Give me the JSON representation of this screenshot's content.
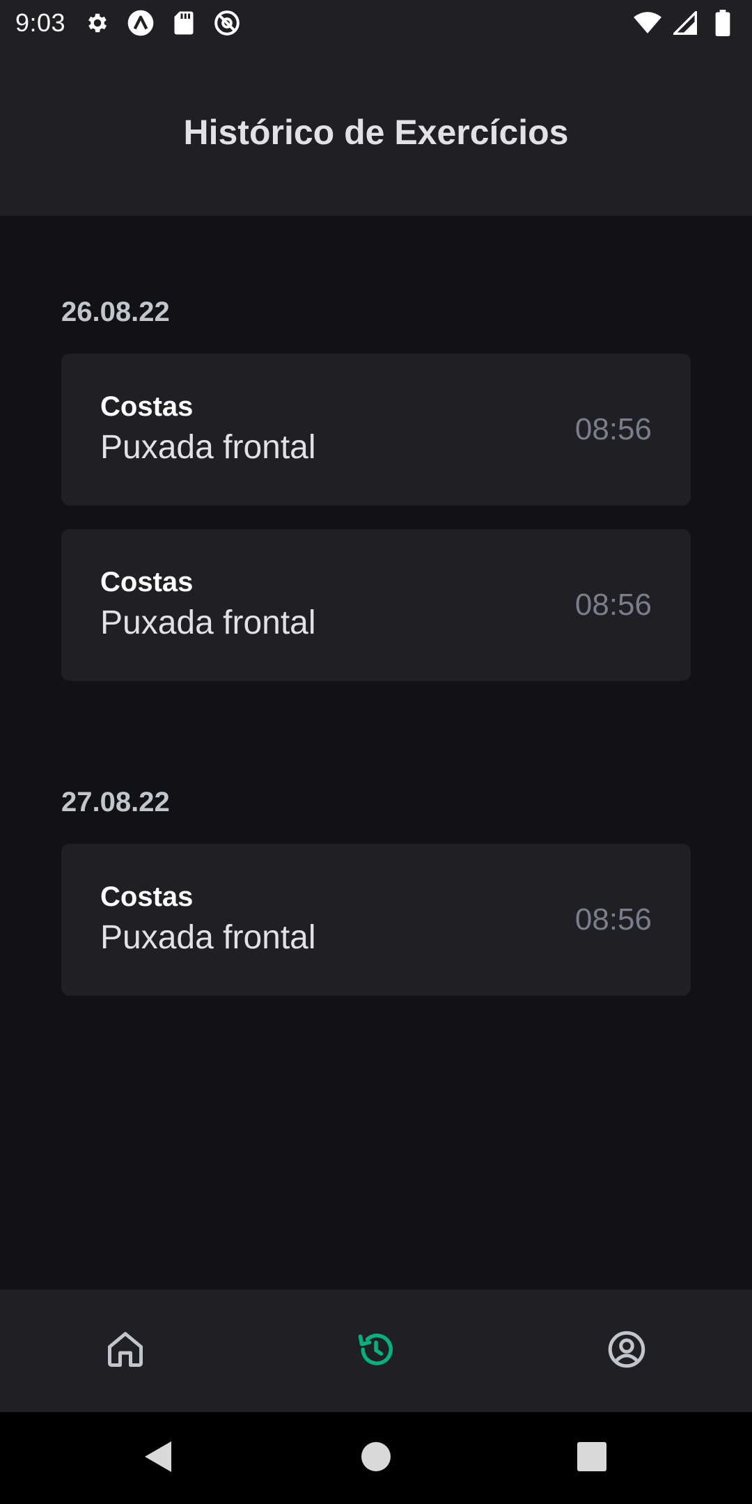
{
  "status_bar": {
    "time": "9:03",
    "icons": [
      "settings-icon",
      "app-logo-icon",
      "sd-card-icon",
      "at-icon"
    ],
    "right_icons": [
      "wifi-icon",
      "signal-icon",
      "battery-icon"
    ]
  },
  "header": {
    "title": "Histórico de Exercícios"
  },
  "history": [
    {
      "date": "26.08.22",
      "items": [
        {
          "group": "Costas",
          "name": "Puxada frontal",
          "time": "08:56"
        },
        {
          "group": "Costas",
          "name": "Puxada frontal",
          "time": "08:56"
        }
      ]
    },
    {
      "date": "27.08.22",
      "items": [
        {
          "group": "Costas",
          "name": "Puxada frontal",
          "time": "08:56"
        }
      ]
    }
  ],
  "tab_bar": {
    "tabs": [
      {
        "icon": "home-icon",
        "active": false
      },
      {
        "icon": "history-icon",
        "active": true
      },
      {
        "icon": "profile-icon",
        "active": false
      }
    ]
  },
  "colors": {
    "accent": "#00B37E",
    "background": "#121214",
    "surface": "#202024",
    "icon_inactive": "#c4c4cc"
  },
  "system_nav": {
    "buttons": [
      "back-icon",
      "home-circle-icon",
      "recents-icon"
    ]
  }
}
